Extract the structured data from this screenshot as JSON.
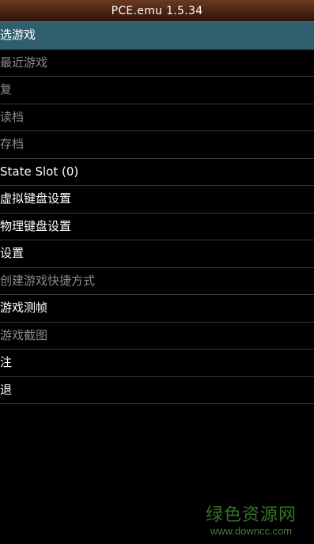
{
  "window": {
    "title": "PCE.emu 1.5.34"
  },
  "menu": {
    "items": [
      {
        "label": "选游戏",
        "state": "selected"
      },
      {
        "label": "最近游戏",
        "state": "disabled"
      },
      {
        "label": "复",
        "state": "disabled"
      },
      {
        "label": "读档",
        "state": "disabled"
      },
      {
        "label": "存档",
        "state": "disabled"
      },
      {
        "label": "State Slot (0)",
        "state": "enabled"
      },
      {
        "label": "虚拟键盘设置",
        "state": "enabled"
      },
      {
        "label": "物理键盘设置",
        "state": "enabled"
      },
      {
        "label": "设置",
        "state": "enabled"
      },
      {
        "label": "创建游戏快捷方式",
        "state": "disabled"
      },
      {
        "label": "游戏测帧",
        "state": "enabled"
      },
      {
        "label": "游戏截图",
        "state": "disabled"
      },
      {
        "label": "注",
        "state": "enabled"
      },
      {
        "label": "退",
        "state": "enabled"
      }
    ]
  },
  "watermark": {
    "name": "绿色资源网",
    "url": "www.downcc.com"
  },
  "colors": {
    "selected_bg": "#2f5f6d",
    "enabled_text": "#ffffff",
    "disabled_text": "#8a8a8a",
    "titlebar": "#4a2414",
    "watermark": "#3e8a2c"
  }
}
